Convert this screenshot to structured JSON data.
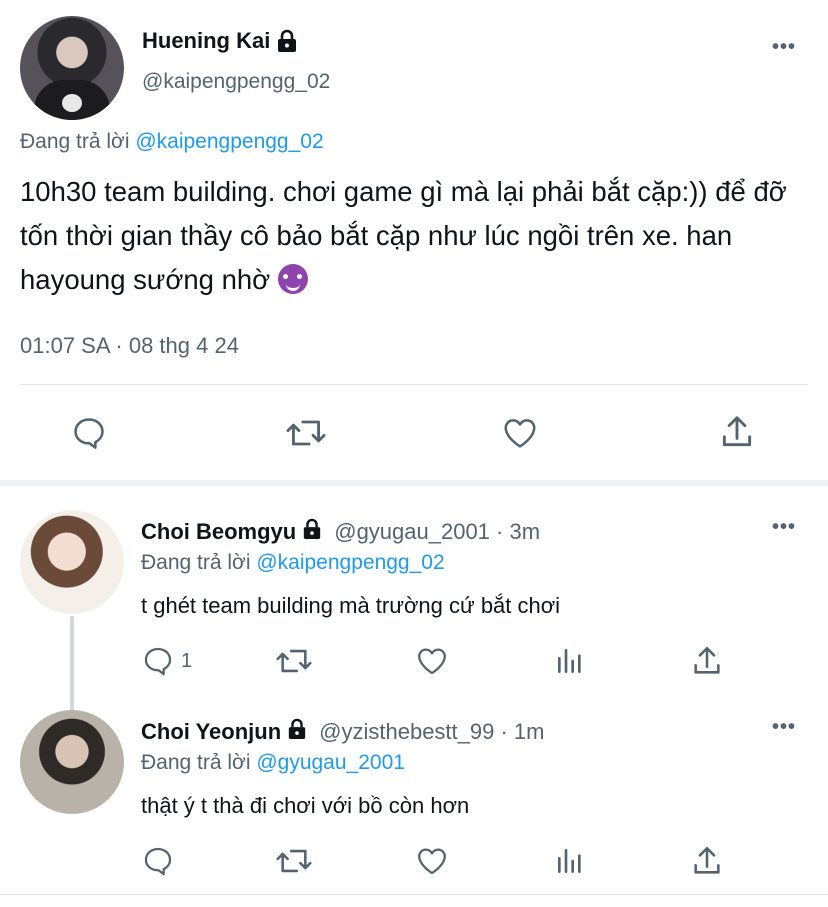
{
  "main_tweet": {
    "author_name": "Huening Kai",
    "author_handle": "@kaipengpengg_02",
    "replying_prefix": "Đang trả lời",
    "replying_to": "@kaipengpengg_02",
    "text": "10h30 team building. chơi game gì mà lại phải bắt cặp:)) để đỡ tốn thời gian thầy cô bảo bắt cặp như lúc ngồi trên xe. han hayoung sướng nhờ",
    "emoji": "smiling-devil-emoji",
    "timestamp": "01:07 SA · 08 thg 4 24",
    "more_label": "•••"
  },
  "replies": [
    {
      "author_name": "Choi Beomgyu",
      "meta": "@gyugau_2001 · 3m",
      "replying_prefix": "Đang trả lời",
      "replying_to": "@kaipengpengg_02",
      "text": "t ghét team building mà trường cứ bắt chơi",
      "reply_count": "1",
      "more_label": "•••"
    },
    {
      "author_name": "Choi Yeonjun",
      "meta": "@yzisthebestt_99 · 1m",
      "replying_prefix": "Đang trả lời",
      "replying_to": "@gyugau_2001",
      "text": "thật ý t thà đi chơi với bồ còn hơn",
      "reply_count": "",
      "more_label": "•••"
    }
  ],
  "colors": {
    "link": "#1d9bf0",
    "secondary_text": "#536471",
    "primary_text": "#0f1419",
    "divider": "#e1e6ea"
  },
  "icons": [
    "lock-icon",
    "more-icon",
    "reply-icon",
    "retweet-icon",
    "like-icon",
    "share-icon",
    "views-icon"
  ]
}
